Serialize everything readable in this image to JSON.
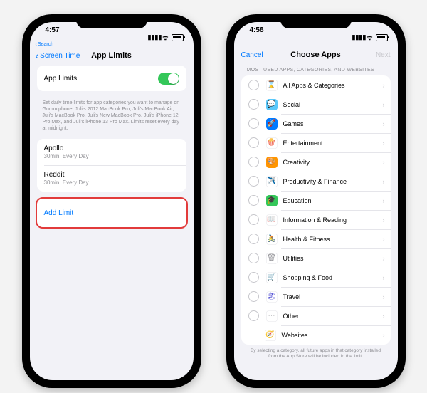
{
  "phone1": {
    "status": {
      "time": "4:57",
      "back_search": "Search"
    },
    "nav": {
      "back": "Screen Time",
      "title": "App Limits"
    },
    "toggle_label": "App Limits",
    "desc": "Set daily time limits for app categories you want to manage on Gummiphone, Juli's 2012 MacBook Pro, Juli's MacBook Air, Juli's MacBook Pro, Juli's New MacBook Pro, Juli's iPhone 12 Pro Max, and Juli's iPhone 13 Pro Max. Limits reset every day at midnight.",
    "limits": [
      {
        "name": "Apollo",
        "sub": "30min, Every Day"
      },
      {
        "name": "Reddit",
        "sub": "30min, Every Day"
      }
    ],
    "add_limit": "Add Limit"
  },
  "phone2": {
    "status": {
      "time": "4:58"
    },
    "nav": {
      "cancel": "Cancel",
      "title": "Choose Apps",
      "next": "Next"
    },
    "section_header": "MOST USED APPS, CATEGORIES, AND WEBSITES",
    "categories": [
      {
        "label": "All Apps & Categories",
        "icon": "⌛",
        "bg": "#ffffff",
        "fg": "#8e8e93"
      },
      {
        "label": "Social",
        "icon": "💬",
        "bg": "#5ac8fa"
      },
      {
        "label": "Games",
        "icon": "🚀",
        "bg": "#007aff"
      },
      {
        "label": "Entertainment",
        "icon": "🍿",
        "bg": "#ffffff",
        "fg": "#ff3b30"
      },
      {
        "label": "Creativity",
        "icon": "🎨",
        "bg": "#ff9500"
      },
      {
        "label": "Productivity & Finance",
        "icon": "✈️",
        "bg": "#ffffff",
        "fg": "#34c759"
      },
      {
        "label": "Education",
        "icon": "🎓",
        "bg": "#34c759"
      },
      {
        "label": "Information & Reading",
        "icon": "📖",
        "bg": "#ffffff",
        "fg": "#ff9500"
      },
      {
        "label": "Health & Fitness",
        "icon": "🚴",
        "bg": "#ffffff",
        "fg": "#5ac8fa"
      },
      {
        "label": "Utilities",
        "icon": "🗑",
        "bg": "#ffffff",
        "fg": "#8e8e93"
      },
      {
        "label": "Shopping & Food",
        "icon": "🛒",
        "bg": "#ffffff",
        "fg": "#ff9500"
      },
      {
        "label": "Travel",
        "icon": "🏖",
        "bg": "#ffffff",
        "fg": "#5856d6"
      },
      {
        "label": "Other",
        "icon": "⋯",
        "bg": "#ffffff",
        "fg": "#8e8e93"
      },
      {
        "label": "Websites",
        "icon": "🧭",
        "bg": "#ffffff",
        "fg": "#8e8e93",
        "no_radio": true
      }
    ],
    "footnote": "By selecting a category, all future apps in that category installed from the App Store will be included in the limit."
  }
}
